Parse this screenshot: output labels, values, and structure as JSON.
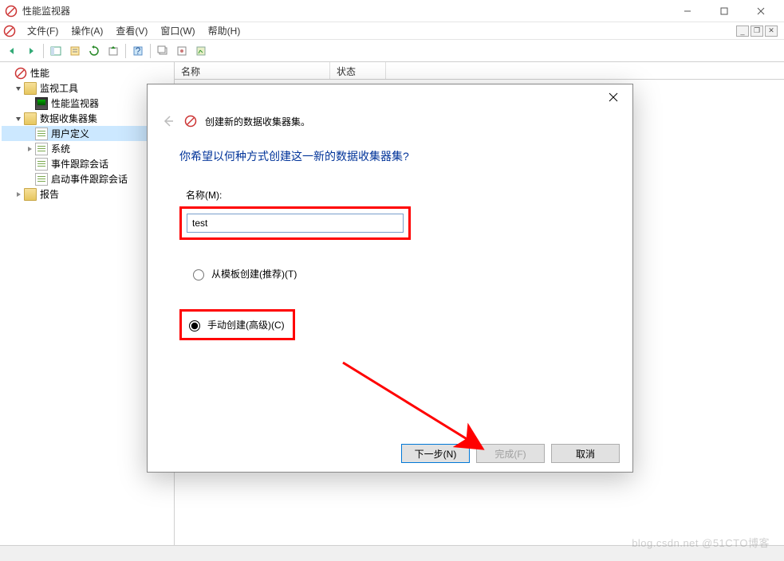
{
  "titlebar": {
    "title": "性能监视器"
  },
  "menubar": {
    "items": [
      "文件(F)",
      "操作(A)",
      "查看(V)",
      "窗口(W)",
      "帮助(H)"
    ]
  },
  "tree": {
    "root": "性能",
    "monitor_tools": "监视工具",
    "perf_monitor": "性能监视器",
    "collector_sets": "数据收集器集",
    "user_defined": "用户定义",
    "system": "系统",
    "event_trace": "事件跟踪会话",
    "startup_trace": "启动事件跟踪会话",
    "reports": "报告"
  },
  "list": {
    "columns": [
      "名称",
      "状态"
    ]
  },
  "dialog": {
    "title": "创建新的数据收集器集。",
    "heading": "你希望以何种方式创建这一新的数据收集器集?",
    "name_label": "名称(M):",
    "name_value": "test",
    "radio_template": "从模板创建(推荐)(T)",
    "radio_manual": "手动创建(高级)(C)",
    "next": "下一步(N)",
    "finish": "完成(F)",
    "cancel": "取消"
  },
  "watermark": "blog.csdn.net  @51CTO博客"
}
